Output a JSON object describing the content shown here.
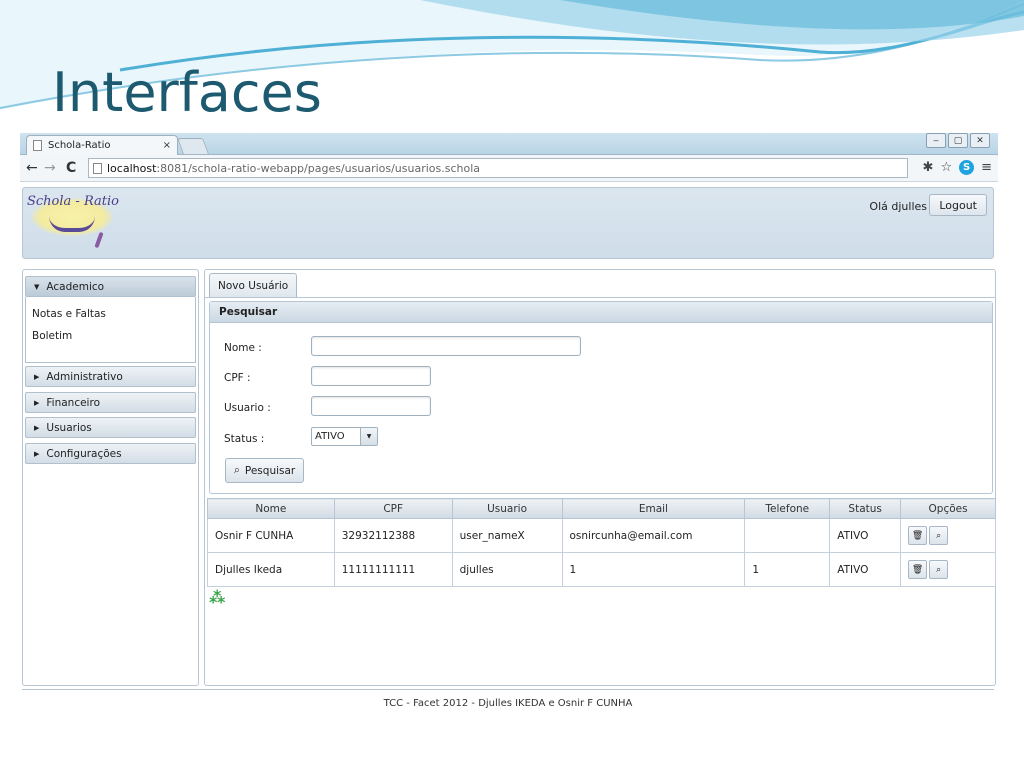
{
  "slide": {
    "title": "Interfaces"
  },
  "browser": {
    "tab_title": "Schola-Ratio",
    "tab_close": "×",
    "url_host": "localhost",
    "url_path": ":8081/schola-ratio-webapp/pages/usuarios/usuarios.schola",
    "win_min": "‒",
    "win_max": "▢",
    "win_close": "✕",
    "nav_back": "←",
    "nav_forward": "→",
    "nav_reload": "C",
    "ext_icon": "✱",
    "star_icon": "☆",
    "skype_letter": "S",
    "menu_icon": "≡"
  },
  "header": {
    "logo_text": "Schola - Ratio",
    "greeting": "Olá djulles",
    "logout_label": "Logout"
  },
  "sidebar": {
    "sections": [
      {
        "label": "Academico",
        "open": true,
        "items": [
          "Notas e Faltas",
          "Boletim"
        ]
      },
      {
        "label": "Administrativo",
        "open": false
      },
      {
        "label": "Financeiro",
        "open": false
      },
      {
        "label": "Usuarios",
        "open": false
      },
      {
        "label": "Configurações",
        "open": false
      }
    ],
    "open_arrow": "▼",
    "closed_arrow": "▶"
  },
  "main": {
    "tab_label": "Novo Usuário",
    "search_panel": {
      "title": "Pesquisar",
      "fields": {
        "nome_label": "Nome :",
        "cpf_label": "CPF :",
        "usuario_label": "Usuario :",
        "status_label": "Status :",
        "nome_value": "",
        "cpf_value": "",
        "usuario_value": "",
        "status_value": "ATIVO"
      },
      "button_label": "Pesquisar",
      "button_icon": "⌕"
    },
    "table": {
      "columns": [
        "Nome",
        "CPF",
        "Usuario",
        "Email",
        "Telefone",
        "Status",
        "Opções"
      ],
      "rows": [
        {
          "nome": "Osnir F CUNHA",
          "cpf": "32932112388",
          "usuario": "user_nameX",
          "email": "osnircunha@email.com",
          "telefone": "",
          "status": "ATIVO"
        },
        {
          "nome": "Djulles Ikeda",
          "cpf": "11111111111",
          "usuario": "djulles",
          "email": "1",
          "telefone": "1",
          "status": "ATIVO"
        }
      ],
      "delete_icon": "🗑",
      "view_icon": "⌕"
    },
    "loading_icon": "⁂"
  },
  "footer": {
    "text": "TCC - Facet 2012 - Djulles IKEDA e Osnir F CUNHA"
  },
  "colors": {
    "title": "#1d5a70",
    "header_bg": "#d5e1ec",
    "wave": "#4fb0d6"
  }
}
